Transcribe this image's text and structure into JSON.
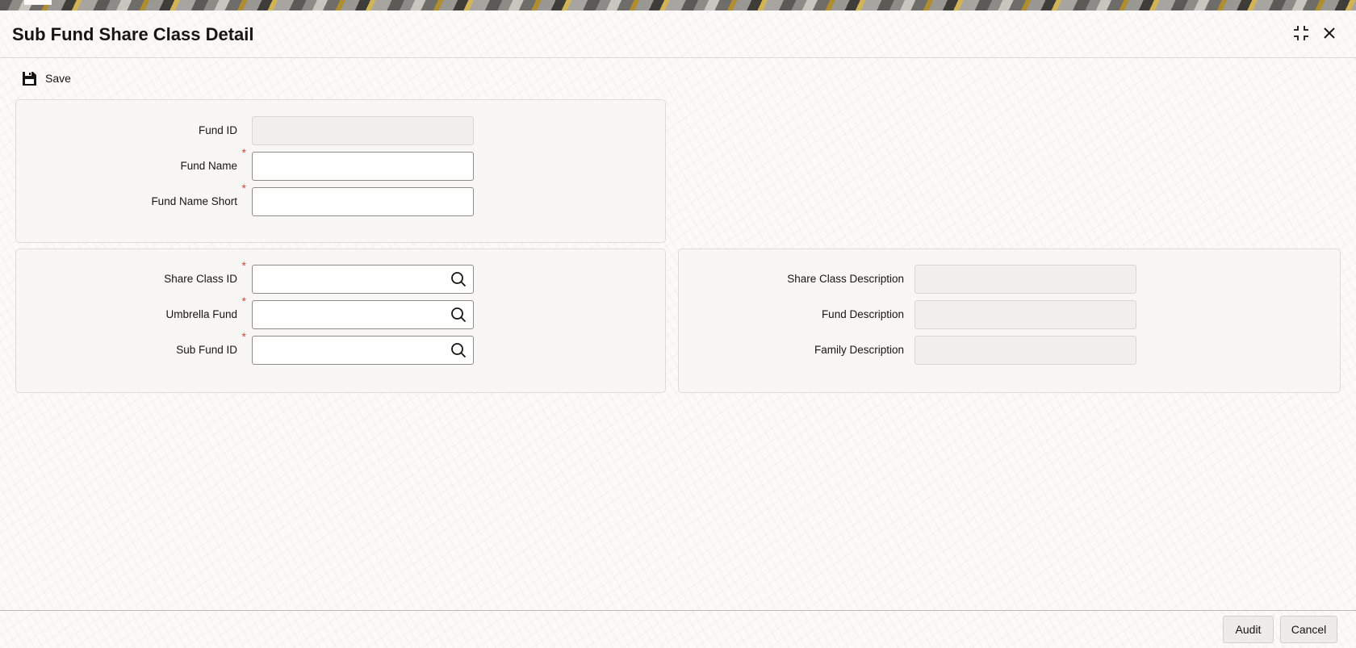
{
  "header": {
    "title": "Sub Fund Share Class Detail",
    "minimize_icon": "collapse-arrows-icon",
    "close_icon": "close-icon"
  },
  "toolbar": {
    "save_label": "Save",
    "save_icon": "floppy-disk-icon"
  },
  "fund_section": {
    "fund_id": {
      "label": "Fund ID",
      "value": "",
      "required": false
    },
    "fund_name": {
      "label": "Fund Name",
      "value": "",
      "required": true
    },
    "fund_name_short": {
      "label": "Fund Name Short",
      "value": "",
      "required": true
    }
  },
  "share_class_section": {
    "share_class_id": {
      "label": "Share Class ID",
      "value": "",
      "required": true
    },
    "umbrella_fund": {
      "label": "Umbrella Fund",
      "value": "",
      "required": true
    },
    "sub_fund_id": {
      "label": "Sub Fund ID",
      "value": "",
      "required": true
    }
  },
  "description_section": {
    "share_class_description": {
      "label": "Share Class Description",
      "value": ""
    },
    "fund_description": {
      "label": "Fund Description",
      "value": ""
    },
    "family_description": {
      "label": "Family Description",
      "value": ""
    }
  },
  "required_marker": "*",
  "lov_icon": "search-icon",
  "footer": {
    "audit_label": "Audit",
    "cancel_label": "Cancel"
  },
  "colors": {
    "required": "#c74634",
    "panel_bg": "#f8f7f5",
    "text": "#161513"
  }
}
